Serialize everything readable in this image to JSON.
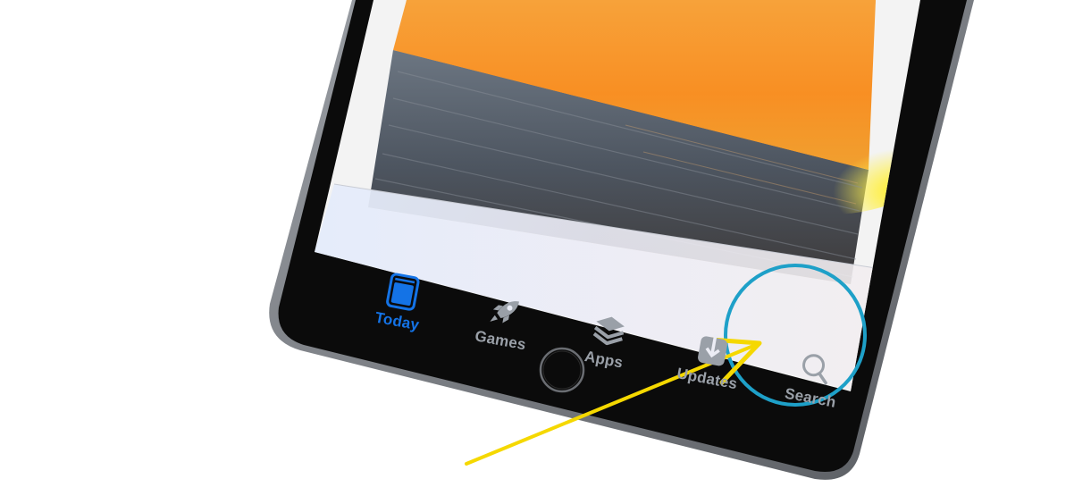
{
  "tabbar": {
    "tabs": [
      {
        "id": "today",
        "label": "Today",
        "icon": "today-icon",
        "active": true
      },
      {
        "id": "games",
        "label": "Games",
        "icon": "rocket-icon",
        "active": false
      },
      {
        "id": "apps",
        "label": "Apps",
        "icon": "layers-icon",
        "active": false
      },
      {
        "id": "updates",
        "label": "Updates",
        "icon": "download-icon",
        "active": false
      },
      {
        "id": "search",
        "label": "Search",
        "icon": "search-icon",
        "active": false
      }
    ]
  },
  "colors": {
    "active_tab": "#1473e6",
    "inactive_tab": "#9aa0a8",
    "highlight_circle": "#1ea0c8",
    "arrow": "#f5d800",
    "device_body": "#0b0b0b"
  }
}
